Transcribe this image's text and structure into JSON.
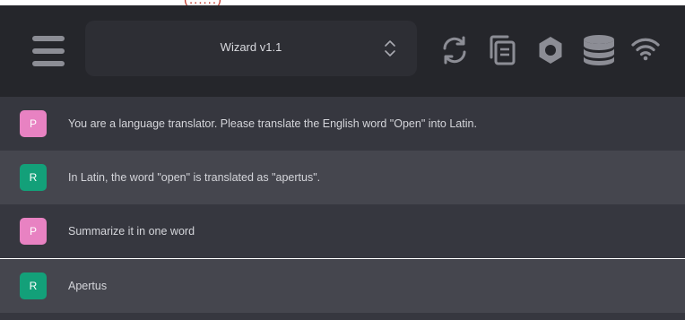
{
  "topbar": {
    "partial_text": "(......)"
  },
  "header": {
    "model_select": {
      "value": "Wizard v1.1"
    },
    "icons": [
      "menu-icon",
      "refresh-icon",
      "copy-icon",
      "settings-gear-icon",
      "database-icon",
      "wifi-icon"
    ],
    "icon_color": "#8c8d95",
    "background": "#25262b"
  },
  "messages": [
    {
      "role": "P",
      "text": "You are a language translator. Please translate the English word \"Open\" into Latin."
    },
    {
      "role": "R",
      "text": "In Latin, the word \"open\" is translated as \"apertus\"."
    },
    {
      "role": "P",
      "text": "Summarize it in one word"
    },
    {
      "role": "R",
      "text": "Apertus"
    }
  ],
  "colors": {
    "prompt_avatar": "#e882c2",
    "reply_avatar": "#13a079",
    "prompt_row": "#36373f",
    "reply_row": "#45464e"
  }
}
